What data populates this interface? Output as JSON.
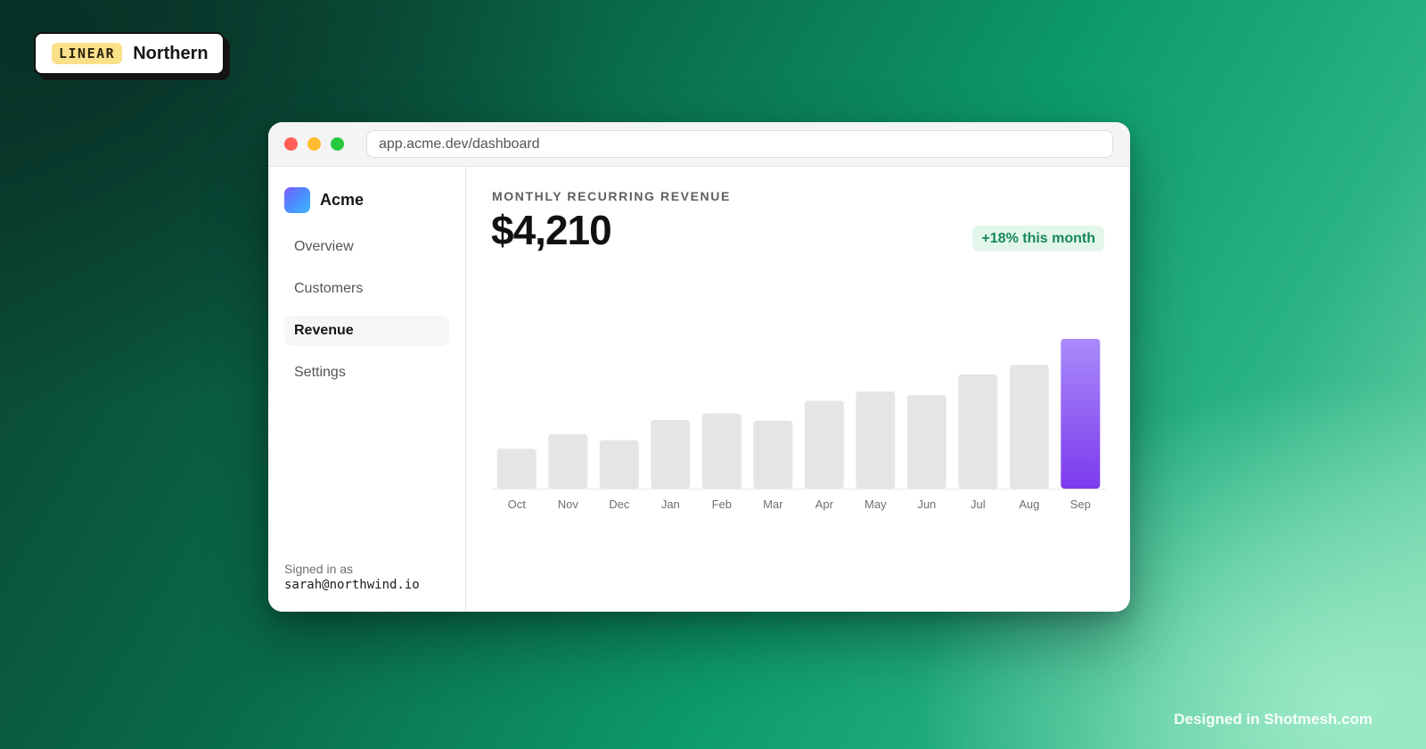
{
  "brand": {
    "tag": "LINEAR",
    "name": "Northern"
  },
  "browser": {
    "url": "app.acme.dev/dashboard"
  },
  "sidebar": {
    "workspace": "Acme",
    "items": [
      {
        "label": "Overview",
        "active": false
      },
      {
        "label": "Customers",
        "active": false
      },
      {
        "label": "Revenue",
        "active": true
      },
      {
        "label": "Settings",
        "active": false
      }
    ],
    "signed_in_label": "Signed in as",
    "signed_in_email": "sarah@northwind.io"
  },
  "main": {
    "kpi_label": "MONTHLY RECURRING REVENUE",
    "kpi_value": "$4,210",
    "delta": "+18% this month"
  },
  "chart_data": {
    "type": "bar",
    "categories": [
      "Oct",
      "Nov",
      "Dec",
      "Jan",
      "Feb",
      "Mar",
      "Apr",
      "May",
      "Jun",
      "Jul",
      "Aug",
      "Sep"
    ],
    "values": [
      1120,
      1530,
      1360,
      1930,
      2110,
      1910,
      2470,
      2730,
      2630,
      3210,
      3480,
      4210
    ],
    "ylim": [
      0,
      4210
    ],
    "highlight_index": 11,
    "colors": {
      "bar": "#e6e5e3",
      "highlight_top": "#a98bfa",
      "highlight_bottom": "#7c3aed",
      "baseline": "#e8e8e8"
    }
  },
  "footer": {
    "credit": "Designed in Shotmesh.com"
  }
}
